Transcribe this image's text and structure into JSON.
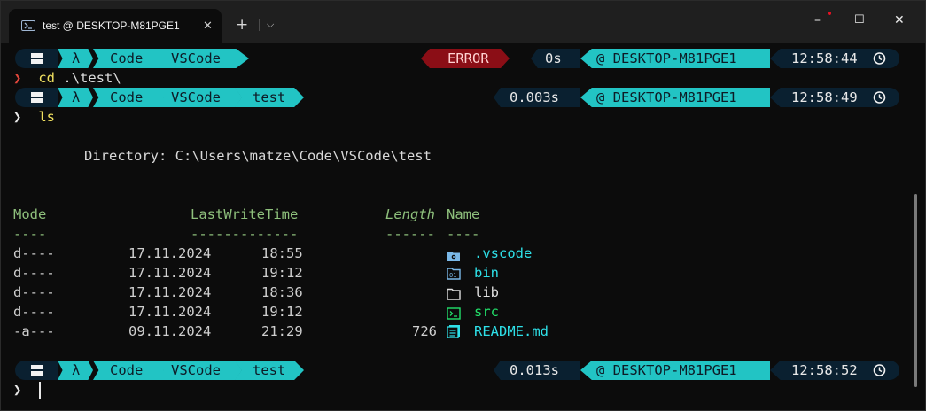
{
  "window": {
    "tab_title": "test @ DESKTOP-M81PGE1",
    "tab_close": "✕",
    "newtab_plus": "+",
    "newtab_dropdown": "⌵",
    "minimize": "–",
    "maximize": "☐",
    "close": "✕"
  },
  "prompt1": {
    "home": "▀▀",
    "lambda": "λ",
    "dirs": [
      "Code",
      "VSCode"
    ],
    "error": "ERROR",
    "duration": "0s",
    "host": "@ DESKTOP-M81PGE1",
    "time": "12:58:44"
  },
  "cmd1": {
    "chevron": "❯",
    "command": "cd",
    "arg": ".\\test\\"
  },
  "prompt2": {
    "home": "▀▀",
    "lambda": "λ",
    "dirs": [
      "Code",
      "VSCode",
      "test"
    ],
    "duration": "0.003s",
    "host": "@ DESKTOP-M81PGE1",
    "time": "12:58:49"
  },
  "cmd2": {
    "chevron": "❯",
    "command": "ls"
  },
  "listing": {
    "directory_line": "Directory: C:\\Users\\matze\\Code\\VSCode\\test",
    "headers": {
      "mode": "Mode",
      "lastwrite": "LastWriteTime",
      "length": "Length",
      "name": "Name"
    },
    "underlines": {
      "mode": "----",
      "lastwrite": "-------------",
      "length": "------",
      "name": "----"
    },
    "rows": [
      {
        "mode": "d----",
        "date": "17.11.2024",
        "time": "18:55",
        "length": "",
        "icon": "folder-gear-icon",
        "name": ".vscode",
        "color": "#2ee0e8"
      },
      {
        "mode": "d----",
        "date": "17.11.2024",
        "time": "19:12",
        "length": "",
        "icon": "folder-binary-icon",
        "name": "bin",
        "color": "#2ee0e8"
      },
      {
        "mode": "d----",
        "date": "17.11.2024",
        "time": "18:36",
        "length": "",
        "icon": "folder-icon",
        "name": "lib",
        "color": "#e0e0e0"
      },
      {
        "mode": "d----",
        "date": "17.11.2024",
        "time": "19:12",
        "length": "",
        "icon": "terminal-folder-icon",
        "name": "src",
        "color": "#22e06a"
      },
      {
        "mode": "-a---",
        "date": "09.11.2024",
        "time": "21:29",
        "length": "726",
        "icon": "file-lines-icon",
        "name": "README.md",
        "color": "#2ee0e8"
      }
    ]
  },
  "prompt3": {
    "home": "▀▀",
    "lambda": "λ",
    "dirs": [
      "Code",
      "VSCode",
      "test"
    ],
    "duration": "0.013s",
    "host": "@ DESKTOP-M81PGE1",
    "time": "12:58:52"
  },
  "cmd3": {
    "chevron": "❯"
  },
  "colors": {
    "segment_cyan": "#22c4c4",
    "segment_dark": "#0a2030",
    "error_red": "#8b0e16",
    "command_yellow": "#f0e060",
    "header_green": "#8ec07c"
  }
}
